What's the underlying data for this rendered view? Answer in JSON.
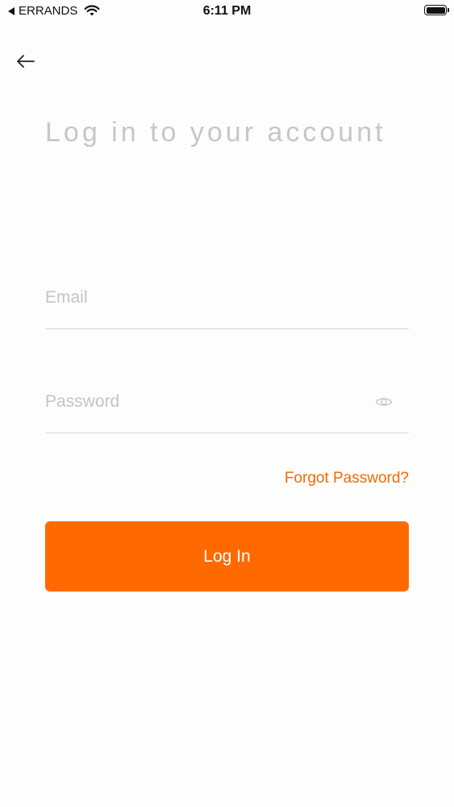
{
  "status_bar": {
    "back_app": "ERRANDS",
    "time": "6:11 PM"
  },
  "header": {
    "back_icon": "back-arrow-icon"
  },
  "title": "Log in to your account",
  "form": {
    "email_placeholder": "Email",
    "password_placeholder": "Password",
    "password_toggle_icon": "eye-icon",
    "forgot_label": "Forgot Password?",
    "login_label": "Log In"
  },
  "colors": {
    "accent": "#ff6a00",
    "link": "#f26a00",
    "title": "#c6c6cc"
  }
}
